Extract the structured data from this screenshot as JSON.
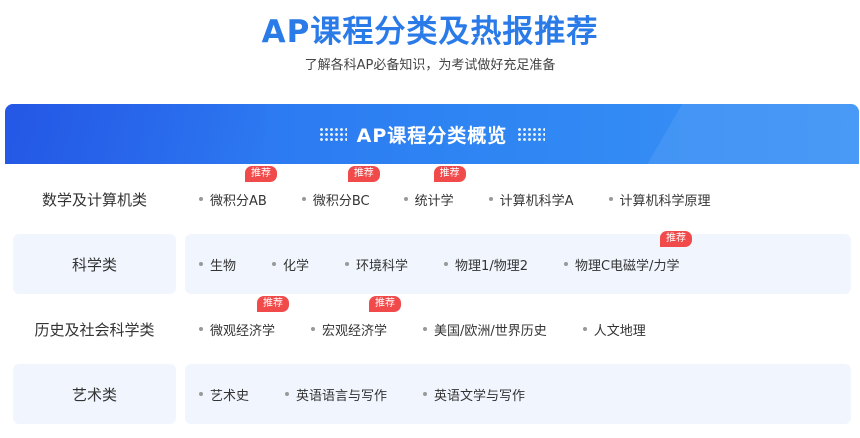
{
  "header": {
    "title": "AP课程分类及热报推荐",
    "subtitle": "了解各科AP必备知识，为考试做好充足准备"
  },
  "banner": {
    "title": "AP课程分类概览"
  },
  "badge_label": "推荐",
  "colors": {
    "accent": "#2a7ae8",
    "badge": "#f04a4a",
    "row_bg": "#f1f6fe"
  },
  "rows": [
    {
      "category": "数学及计算机类",
      "courses": [
        {
          "label": "微积分AB",
          "recommended": true
        },
        {
          "label": "微积分BC",
          "recommended": true
        },
        {
          "label": "统计学",
          "recommended": true
        },
        {
          "label": "计算机科学A",
          "recommended": false
        },
        {
          "label": "计算机科学原理",
          "recommended": false
        }
      ]
    },
    {
      "category": "科学类",
      "courses": [
        {
          "label": "生物",
          "recommended": false
        },
        {
          "label": "化学",
          "recommended": false
        },
        {
          "label": "环境科学",
          "recommended": false
        },
        {
          "label": "物理1/物理2",
          "recommended": false
        },
        {
          "label": "物理C电磁学/力学",
          "recommended": true
        }
      ]
    },
    {
      "category": "历史及社会科学类",
      "courses": [
        {
          "label": "微观经济学",
          "recommended": true
        },
        {
          "label": "宏观经济学",
          "recommended": true
        },
        {
          "label": "美国/欧洲/世界历史",
          "recommended": false
        },
        {
          "label": "人文地理",
          "recommended": false
        }
      ]
    },
    {
      "category": "艺术类",
      "courses": [
        {
          "label": "艺术史",
          "recommended": false
        },
        {
          "label": "英语语言与写作",
          "recommended": false
        },
        {
          "label": "英语文学与写作",
          "recommended": false
        }
      ]
    }
  ]
}
